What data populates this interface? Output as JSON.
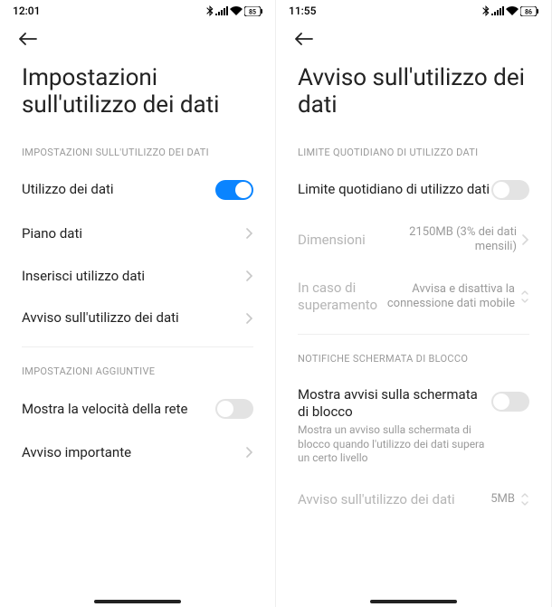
{
  "left": {
    "status_time": "12:01",
    "battery": "85",
    "title": "Impostazioni sull'utilizzo dei dati",
    "section1_header": "IMPOSTAZIONI SULL'UTILIZZO DEI DATI",
    "rows1": {
      "data_usage_label": "Utilizzo dei dati",
      "data_plan_label": "Piano dati",
      "enter_usage_label": "Inserisci utilizzo dati",
      "usage_warning_label": "Avviso sull'utilizzo dei dati"
    },
    "section2_header": "IMPOSTAZIONI AGGIUNTIVE",
    "rows2": {
      "show_speed_label": "Mostra la velocità della rete",
      "important_notice_label": "Avviso importante"
    }
  },
  "right": {
    "status_time": "11:55",
    "battery": "86",
    "title": "Avviso sull'utilizzo dei dati",
    "section1_header": "LIMITE QUOTIDIANO DI UTILIZZO DATI",
    "rows1": {
      "daily_limit_label": "Limite quotidiano di utilizzo dati",
      "size_label": "Dimensioni",
      "size_value": "2150MB (3% dei dati mensili)",
      "over_label": "In caso di superamento",
      "over_value": "Avvisa e disattiva la connessione dati mobile"
    },
    "section2_header": "NOTIFICHE SCHERMATA DI BLOCCO",
    "rows2": {
      "lock_label": "Mostra avvisi sulla schermata di blocco",
      "lock_sub": "Mostra un avviso sulla schermata di blocco quando l'utilizzo dei dati supera un certo livello",
      "usage_warning_label": "Avviso sull'utilizzo dei dati",
      "usage_warning_value": "5MB"
    }
  }
}
